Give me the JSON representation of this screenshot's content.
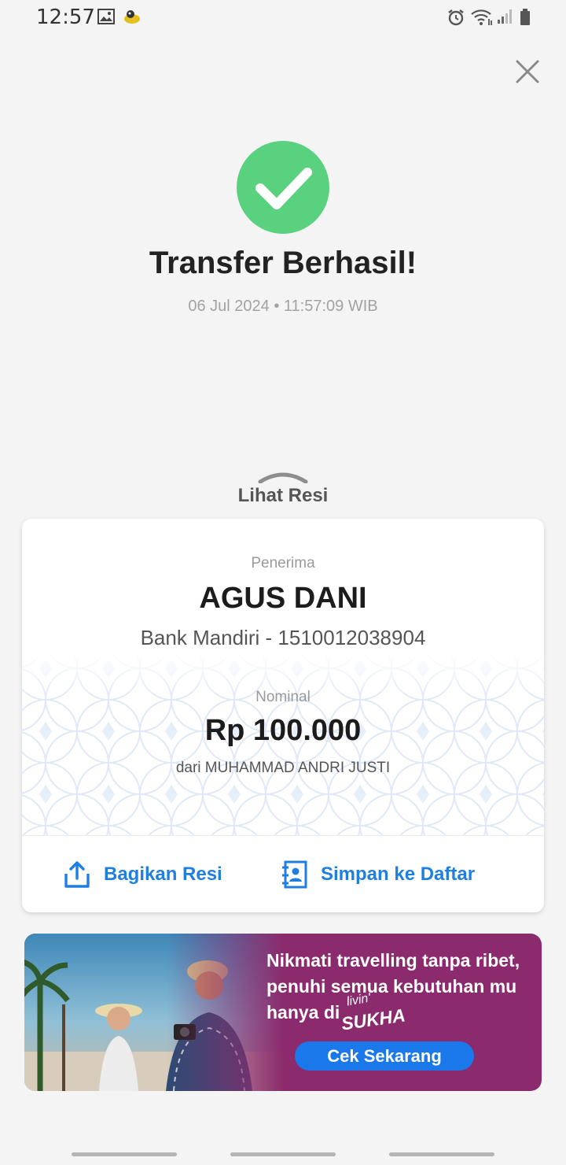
{
  "status_bar": {
    "time": "12:57"
  },
  "result": {
    "title": "Transfer Berhasil!",
    "datetime": "06 Jul 2024 • 11:57:09 WIB"
  },
  "receipt_toggle": {
    "label": "Lihat Resi"
  },
  "receipt": {
    "recipient_label": "Penerima",
    "recipient_name": "AGUS DANI",
    "recipient_bank": "Bank Mandiri - 1510012038904",
    "amount_label": "Nominal",
    "amount": "Rp 100.000",
    "sender": "dari MUHAMMAD ANDRI JUSTI"
  },
  "actions": {
    "share_label": "Bagikan Resi",
    "save_label": "Simpan ke Daftar"
  },
  "promo": {
    "line1": "Nikmati travelling tanpa ribet,",
    "line2": "penuhi semua kebutuhan mu",
    "line3": "hanya di",
    "brand_small": "livin'",
    "brand": "SUKHA",
    "cta": "Cek Sekarang"
  },
  "colors": {
    "success": "#5ad17e",
    "accent": "#1f7fe0",
    "promo_bg": "#8b2a6c"
  }
}
